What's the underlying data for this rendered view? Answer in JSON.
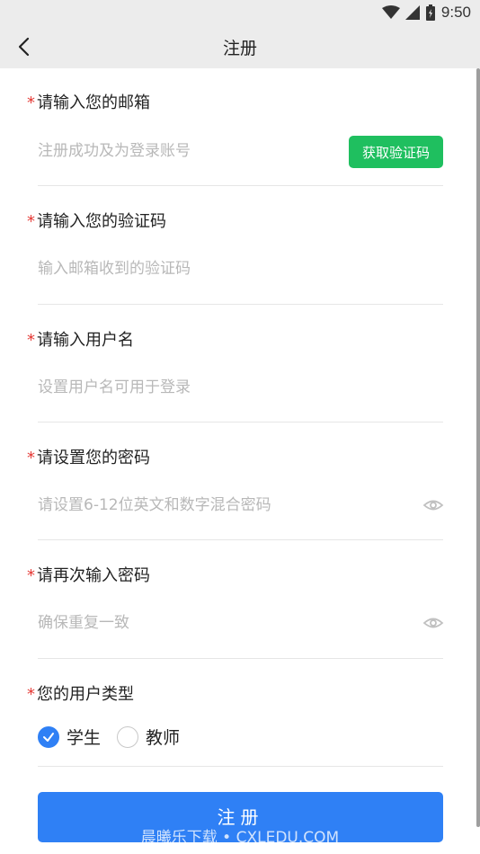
{
  "status_bar": {
    "time": "9:50"
  },
  "header": {
    "title": "注册"
  },
  "fields": {
    "email": {
      "label": "请输入您的邮箱",
      "placeholder": "注册成功及为登录账号",
      "button": "获取验证码"
    },
    "code": {
      "label": "请输入您的验证码",
      "placeholder": "输入邮箱收到的验证码"
    },
    "username": {
      "label": "请输入用户名",
      "placeholder": "设置用户名可用于登录"
    },
    "password": {
      "label": "请设置您的密码",
      "placeholder": "请设置6-12位英文和数字混合密码"
    },
    "password_confirm": {
      "label": "请再次输入密码",
      "placeholder": "确保重复一致"
    }
  },
  "user_type": {
    "label": "您的用户类型",
    "options": [
      {
        "label": "学生",
        "selected": true
      },
      {
        "label": "教师",
        "selected": false
      }
    ]
  },
  "required_mark": "*",
  "submit_label": "注册",
  "watermark": "晨曦乐下载 • CXLEDU.COM",
  "colors": {
    "accent": "#2f80f5",
    "code_button": "#1fbf5f",
    "required": "#e53935",
    "placeholder": "#b8b8b8"
  }
}
